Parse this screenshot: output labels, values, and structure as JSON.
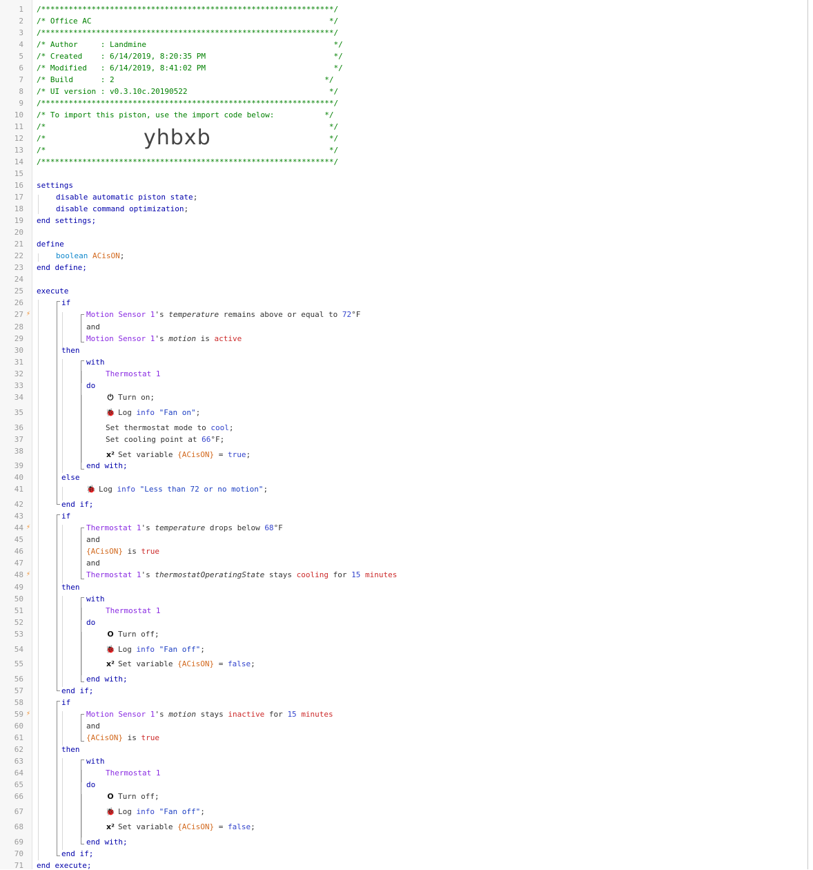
{
  "header": {
    "line1": "/****************************************************************/",
    "title": "/* Office AC                                                    */",
    "line3": "/****************************************************************/",
    "author": "/* Author     : Landmine                                         */",
    "created": "/* Created    : 6/14/2019, 8:20:35 PM                            */",
    "modified": "/* Modified   : 6/14/2019, 8:41:02 PM                            */",
    "build": "/* Build      : 2                                              */",
    "ui_version": "/* UI version : v0.3.10c.20190522                               */",
    "line9": "/****************************************************************/",
    "import_note": "/* To import this piston, use the import code below:           */",
    "blank11": "/*                                                              */",
    "blank12": "/*                                                              */",
    "blank13": "/*                                                              */",
    "line14": "/****************************************************************/",
    "import_code": "yhbxb"
  },
  "kw": {
    "settings": "settings",
    "disable": "disable",
    "automatic_piston_state": "automatic piston state",
    "command_optimization": "command optimization",
    "semicolon": ";",
    "end_settings": "end settings;",
    "define": "define",
    "boolean": "boolean",
    "end_define": "end define;",
    "execute": "execute",
    "if": "if",
    "and": "and",
    "then": "then",
    "with": "with",
    "do": "do",
    "end_with": "end with;",
    "else": "else",
    "end_if": "end if;",
    "end_execute": "end execute;"
  },
  "devices": {
    "motion_sensor": "Motion Sensor 1",
    "thermostat": "Thermostat 1"
  },
  "variables": {
    "acison_plain": "ACisON",
    "acison": "{ACisON}"
  },
  "text": {
    "possessive": "'s ",
    "temperature": "temperature",
    "motion": "motion",
    "thermostat_op_state": "thermostatOperatingState",
    "remains_above_or_equal_to": " remains above or equal to ",
    "is": " is ",
    "drops_below": " drops below ",
    "stays": " stays ",
    "for": " for ",
    "f": "°F",
    "turn_on": "Turn on;",
    "turn_off": "Turn off;",
    "log": "Log ",
    "info": "info",
    "set_mode": "Set thermostat mode to ",
    "set_cooling": "Set cooling point at ",
    "set_variable": "Set variable ",
    "equals": " = ",
    "semi": ";",
    "f_semi": "°F;"
  },
  "values": {
    "v72": "72",
    "v68": "68",
    "v66": "66",
    "v15": "15",
    "active": "active",
    "inactive": "inactive",
    "cooling": "cooling",
    "minutes": "minutes",
    "cool": "cool",
    "true": "true",
    "false": "false",
    "fan_on": "\"Fan on\"",
    "fan_off": "\"Fan off\"",
    "less_than_72": "\"Less than 72 or no motion\""
  },
  "icons": {
    "power_on": "power-on-icon",
    "power_off": "power-off-icon",
    "bug": "bug-icon",
    "variable": "variable-icon"
  },
  "line_numbers": [
    "1",
    "2",
    "3",
    "4",
    "5",
    "6",
    "7",
    "8",
    "9",
    "10",
    "11",
    "12",
    "13",
    "14",
    "15",
    "16",
    "17",
    "18",
    "19",
    "20",
    "21",
    "22",
    "23",
    "24",
    "25",
    "26",
    "27",
    "28",
    "29",
    "30",
    "31",
    "32",
    "33",
    "34",
    "35",
    "36",
    "37",
    "38",
    "39",
    "40",
    "41",
    "42",
    "43",
    "44",
    "45",
    "46",
    "47",
    "48",
    "49",
    "50",
    "51",
    "52",
    "53",
    "54",
    "55",
    "56",
    "57",
    "58",
    "59",
    "60",
    "61",
    "62",
    "63",
    "64",
    "65",
    "66",
    "67",
    "68",
    "69",
    "70",
    "71"
  ],
  "trigger_marker": "⚡",
  "colors": {
    "comment": "#008000",
    "keyword": "#0000aa",
    "device": "#8a2be2",
    "variable": "#d2691e",
    "active": "#cc2a2a",
    "trigger": "#f08a24"
  }
}
